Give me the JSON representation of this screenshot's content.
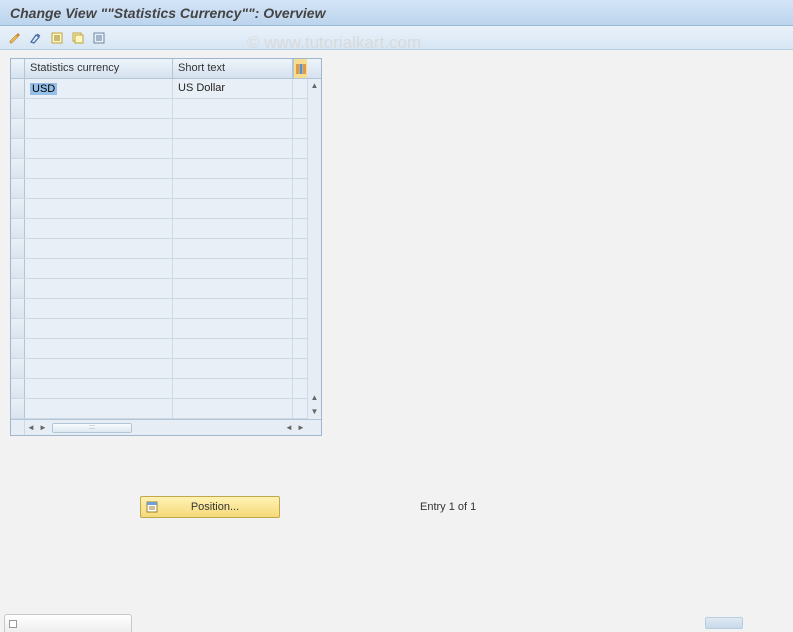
{
  "title": "Change View \"\"Statistics Currency\"\": Overview",
  "watermark": "© www.tutorialkart.com",
  "toolbar": {
    "icons": [
      "display-change-icon",
      "other-entry-icon",
      "new-entries-icon",
      "copy-icon",
      "delete-icon"
    ]
  },
  "grid": {
    "columns": [
      "Statistics currency",
      "Short text"
    ],
    "rows": [
      {
        "currency": "USD",
        "short_text": "US Dollar"
      }
    ],
    "empty_rows": 16,
    "hscroll_thumb": ":::"
  },
  "actions": {
    "position_label": "Position..."
  },
  "status": {
    "entry_text": "Entry 1 of 1"
  }
}
